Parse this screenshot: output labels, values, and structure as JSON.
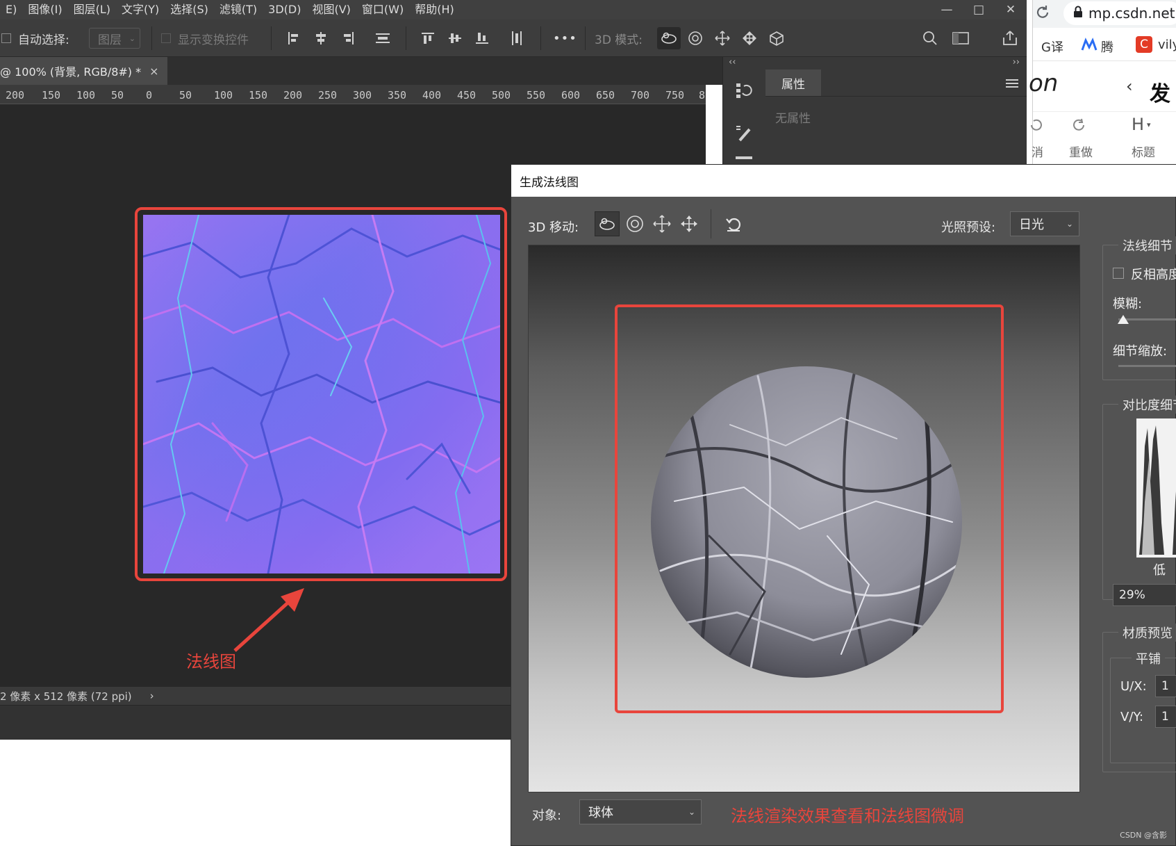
{
  "menu": {
    "items": [
      "E)",
      "图像(I)",
      "图层(L)",
      "文字(Y)",
      "选择(S)",
      "滤镜(T)",
      "3D(D)",
      "视图(V)",
      "窗口(W)",
      "帮助(H)"
    ]
  },
  "options_bar": {
    "auto_select_label": "自动选择:",
    "layer_select_value": "图层",
    "show_transform_label": "显示变换控件",
    "mode_3d_label": "3D 模式:",
    "more_label": "•••"
  },
  "document": {
    "tab_title": "@ 100% (背景, RGB/8#) *",
    "tab_close": "×",
    "ruler_ticks": [
      "200",
      "150",
      "100",
      "50",
      "0",
      "50",
      "100",
      "150",
      "200",
      "250",
      "300",
      "350",
      "400",
      "450",
      "500",
      "550",
      "600",
      "650",
      "700",
      "750",
      "8"
    ],
    "status_text": "2 像素 x 512 像素 (72 ppi)",
    "status_arrow": "›"
  },
  "properties_panel": {
    "tab_label": "属性",
    "collapse_left": "‹‹",
    "collapse_right": "››",
    "empty_text": "无属性"
  },
  "annotations": {
    "normal_map_label": "法线图",
    "dialog_caption": "法线渲染效果查看和法线图微调"
  },
  "browser": {
    "url": "mp.csdn.net",
    "bookmark_1": "G译",
    "bookmark_2": "腾",
    "bookmark_3": "vily",
    "logo_fragment": "on",
    "publish_fragment": "发布",
    "undo_label": "消",
    "redo_label": "重做",
    "heading_icon": "H",
    "heading_label": "标题"
  },
  "dialog": {
    "title": "生成法线图",
    "move_3d_label": "3D 移动:",
    "light_preset_label": "光照预设:",
    "light_preset_value": "日光",
    "object_label": "对象:",
    "object_value": "球体",
    "detail_group": {
      "title": "法线细节",
      "invert_label": "反相高度",
      "blur_label": "模糊:",
      "blur_value": 0.03,
      "scale_label": "细节缩放:"
    },
    "contrast_group": {
      "title": "对比度细节",
      "low_label": "低",
      "percent_value": "29%"
    },
    "material_group": {
      "title": "材质预览",
      "tile_title": "平铺",
      "ux_label": "U/X:",
      "ux_value": "1",
      "vy_label": "V/Y:",
      "vy_value": "1"
    }
  },
  "watermark": "CSDN @含影"
}
